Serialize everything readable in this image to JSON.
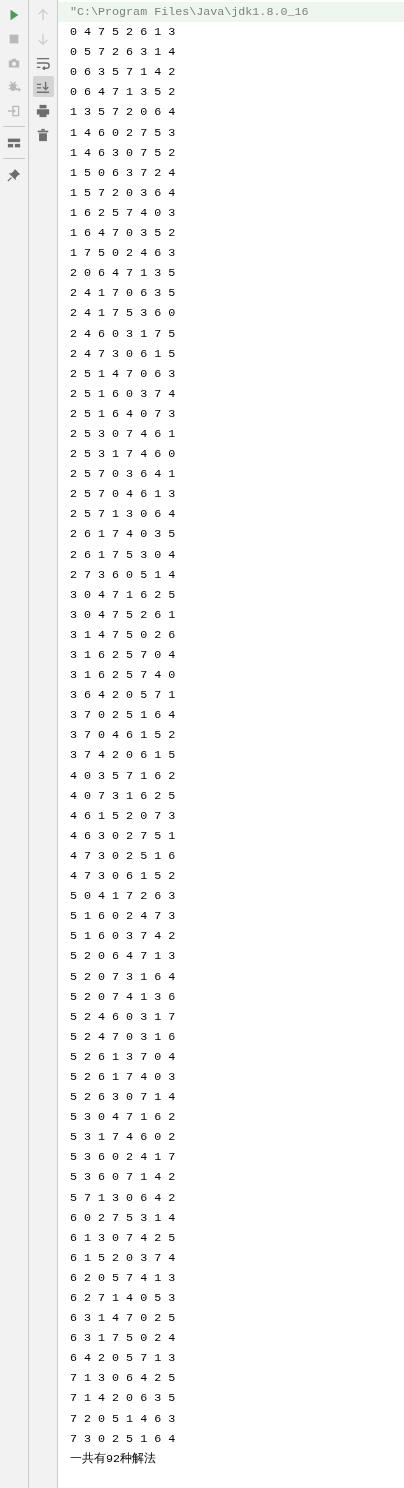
{
  "left_toolbar": {
    "groups": [
      [
        {
          "kind": "run",
          "disabled": false
        },
        {
          "kind": "stop",
          "disabled": true
        },
        {
          "kind": "camera",
          "disabled": true
        },
        {
          "kind": "debug",
          "disabled": true
        },
        {
          "kind": "enter",
          "disabled": true
        }
      ],
      [
        {
          "kind": "layout",
          "disabled": false
        }
      ],
      [
        {
          "kind": "pin",
          "disabled": false
        }
      ]
    ]
  },
  "right_toolbar": {
    "items": [
      {
        "kind": "up",
        "disabled": true,
        "selected": false
      },
      {
        "kind": "down",
        "disabled": true,
        "selected": false
      },
      {
        "kind": "wrap",
        "disabled": false,
        "selected": false
      },
      {
        "kind": "scroll-end",
        "disabled": false,
        "selected": true
      },
      {
        "kind": "print",
        "disabled": false,
        "selected": false
      },
      {
        "kind": "trash",
        "disabled": false,
        "selected": false
      }
    ]
  },
  "console": {
    "lines": [
      {
        "kind": "command",
        "text": "\"C:\\Program Files\\Java\\jdk1.8.0_16"
      },
      {
        "kind": "output",
        "text": "0 4 7 5 2 6 1 3"
      },
      {
        "kind": "output",
        "text": "0 5 7 2 6 3 1 4"
      },
      {
        "kind": "output",
        "text": "0 6 3 5 7 1 4 2"
      },
      {
        "kind": "output",
        "text": "0 6 4 7 1 3 5 2"
      },
      {
        "kind": "output",
        "text": "1 3 5 7 2 0 6 4"
      },
      {
        "kind": "output",
        "text": "1 4 6 0 2 7 5 3"
      },
      {
        "kind": "output",
        "text": "1 4 6 3 0 7 5 2"
      },
      {
        "kind": "output",
        "text": "1 5 0 6 3 7 2 4"
      },
      {
        "kind": "output",
        "text": "1 5 7 2 0 3 6 4"
      },
      {
        "kind": "output",
        "text": "1 6 2 5 7 4 0 3"
      },
      {
        "kind": "output",
        "text": "1 6 4 7 0 3 5 2"
      },
      {
        "kind": "output",
        "text": "1 7 5 0 2 4 6 3"
      },
      {
        "kind": "output",
        "text": "2 0 6 4 7 1 3 5"
      },
      {
        "kind": "output",
        "text": "2 4 1 7 0 6 3 5"
      },
      {
        "kind": "output",
        "text": "2 4 1 7 5 3 6 0"
      },
      {
        "kind": "output",
        "text": "2 4 6 0 3 1 7 5"
      },
      {
        "kind": "output",
        "text": "2 4 7 3 0 6 1 5"
      },
      {
        "kind": "output",
        "text": "2 5 1 4 7 0 6 3"
      },
      {
        "kind": "output",
        "text": "2 5 1 6 0 3 7 4"
      },
      {
        "kind": "output",
        "text": "2 5 1 6 4 0 7 3"
      },
      {
        "kind": "output",
        "text": "2 5 3 0 7 4 6 1"
      },
      {
        "kind": "output",
        "text": "2 5 3 1 7 4 6 0"
      },
      {
        "kind": "output",
        "text": "2 5 7 0 3 6 4 1"
      },
      {
        "kind": "output",
        "text": "2 5 7 0 4 6 1 3"
      },
      {
        "kind": "output",
        "text": "2 5 7 1 3 0 6 4"
      },
      {
        "kind": "output",
        "text": "2 6 1 7 4 0 3 5"
      },
      {
        "kind": "output",
        "text": "2 6 1 7 5 3 0 4"
      },
      {
        "kind": "output",
        "text": "2 7 3 6 0 5 1 4"
      },
      {
        "kind": "output",
        "text": "3 0 4 7 1 6 2 5"
      },
      {
        "kind": "output",
        "text": "3 0 4 7 5 2 6 1"
      },
      {
        "kind": "output",
        "text": "3 1 4 7 5 0 2 6"
      },
      {
        "kind": "output",
        "text": "3 1 6 2 5 7 0 4"
      },
      {
        "kind": "output",
        "text": "3 1 6 2 5 7 4 0"
      },
      {
        "kind": "output",
        "text": "3 6 4 2 0 5 7 1"
      },
      {
        "kind": "output",
        "text": "3 7 0 2 5 1 6 4"
      },
      {
        "kind": "output",
        "text": "3 7 0 4 6 1 5 2"
      },
      {
        "kind": "output",
        "text": "3 7 4 2 0 6 1 5"
      },
      {
        "kind": "output",
        "text": "4 0 3 5 7 1 6 2"
      },
      {
        "kind": "output",
        "text": "4 0 7 3 1 6 2 5"
      },
      {
        "kind": "output",
        "text": "4 6 1 5 2 0 7 3"
      },
      {
        "kind": "output",
        "text": "4 6 3 0 2 7 5 1"
      },
      {
        "kind": "output",
        "text": "4 7 3 0 2 5 1 6"
      },
      {
        "kind": "output",
        "text": "4 7 3 0 6 1 5 2"
      },
      {
        "kind": "output",
        "text": "5 0 4 1 7 2 6 3"
      },
      {
        "kind": "output",
        "text": "5 1 6 0 2 4 7 3"
      },
      {
        "kind": "output",
        "text": "5 1 6 0 3 7 4 2"
      },
      {
        "kind": "output",
        "text": "5 2 0 6 4 7 1 3"
      },
      {
        "kind": "output",
        "text": "5 2 0 7 3 1 6 4"
      },
      {
        "kind": "output",
        "text": "5 2 0 7 4 1 3 6"
      },
      {
        "kind": "output",
        "text": "5 2 4 6 0 3 1 7"
      },
      {
        "kind": "output",
        "text": "5 2 4 7 0 3 1 6"
      },
      {
        "kind": "output",
        "text": "5 2 6 1 3 7 0 4"
      },
      {
        "kind": "output",
        "text": "5 2 6 1 7 4 0 3"
      },
      {
        "kind": "output",
        "text": "5 2 6 3 0 7 1 4"
      },
      {
        "kind": "output",
        "text": "5 3 0 4 7 1 6 2"
      },
      {
        "kind": "output",
        "text": "5 3 1 7 4 6 0 2"
      },
      {
        "kind": "output",
        "text": "5 3 6 0 2 4 1 7"
      },
      {
        "kind": "output",
        "text": "5 3 6 0 7 1 4 2"
      },
      {
        "kind": "output",
        "text": "5 7 1 3 0 6 4 2"
      },
      {
        "kind": "output",
        "text": "6 0 2 7 5 3 1 4"
      },
      {
        "kind": "output",
        "text": "6 1 3 0 7 4 2 5"
      },
      {
        "kind": "output",
        "text": "6 1 5 2 0 3 7 4"
      },
      {
        "kind": "output",
        "text": "6 2 0 5 7 4 1 3"
      },
      {
        "kind": "output",
        "text": "6 2 7 1 4 0 5 3"
      },
      {
        "kind": "output",
        "text": "6 3 1 4 7 0 2 5"
      },
      {
        "kind": "output",
        "text": "6 3 1 7 5 0 2 4"
      },
      {
        "kind": "output",
        "text": "6 4 2 0 5 7 1 3"
      },
      {
        "kind": "output",
        "text": "7 1 3 0 6 4 2 5"
      },
      {
        "kind": "output",
        "text": "7 1 4 2 0 6 3 5"
      },
      {
        "kind": "output",
        "text": "7 2 0 5 1 4 6 3"
      },
      {
        "kind": "output",
        "text": "7 3 0 2 5 1 6 4"
      },
      {
        "kind": "output",
        "text": "一共有92种解法"
      }
    ]
  }
}
